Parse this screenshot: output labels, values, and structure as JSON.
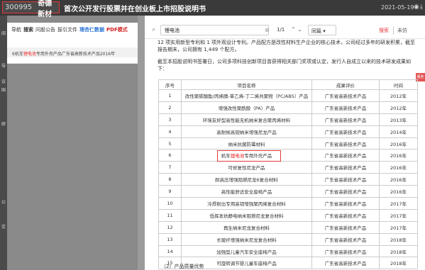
{
  "header": {
    "stock_code": "300995",
    "company": "奇德新材",
    "title": "首次公开发行股票并在创业板上市招股说明书",
    "date": "2021-05-19",
    "icons": [
      "eye-icon",
      "download-icon"
    ]
  },
  "left_strip": {
    "labels": [
      "阅",
      "导",
      "议",
      "国",
      "研",
      "公",
      "交"
    ]
  },
  "panel": {
    "tabs": [
      {
        "label": "导航",
        "style": "normal"
      },
      {
        "label": "搜索",
        "style": "active"
      },
      {
        "label": "问股公告",
        "style": "normal"
      },
      {
        "label": "拔引文件",
        "style": "normal"
      },
      {
        "label": "理杏仁数据",
        "style": "blue"
      },
      {
        "label": "PDF模式",
        "style": "red"
      }
    ],
    "result": {
      "prefix": "6机车",
      "highlight": "锂电池",
      "suffix": "专用外壳产品广东省高新技术产品2016年"
    }
  },
  "search": {
    "icon": "search-icon",
    "query": "锂电池",
    "clear_icon": "clear-icon",
    "count": "1/1",
    "prev_icon": "chevron-up-icon",
    "next_icon": "chevron-down-icon",
    "scope": "同篇 ▾",
    "search_button": "搜索",
    "cancel_button": "未仿"
  },
  "document": {
    "intro_line1": "12 项实用新型专利和 1 项外观设计专利。产品配方是改性材料生产企业的核心技术，公司经过多年的研发积累，截至",
    "intro_line2": "报告期末，公司拥有 1,449 个配方。",
    "para_line1": "截至本招股说明书签署日，公司多项科技创新项目曾获得相关部门奖项或认定，发行人自成立以来的技术研发成果如",
    "para_line2": "下：",
    "feedback_button": "服务",
    "table": {
      "headers": [
        "序号",
        "项目名称",
        "成果评价",
        "时间"
      ],
      "rows": [
        [
          "1",
          "改性聚碳酸酯/丙烯腈-苯乙烯-丁二烯共聚物（PC/ABS）产品",
          "广东省高新技术产品",
          "2012年"
        ],
        [
          "2",
          "增强改性聚酰胺（PA）产品",
          "广东省高新技术产品",
          "2012年"
        ],
        [
          "3",
          "环境友好型高性能无机纳米复合聚丙烯材料",
          "广东省高新技术产品",
          "2013年"
        ],
        [
          "4",
          "高耐候高韧纳米增强尼龙产品",
          "广东省高新技术产品",
          "2014年"
        ],
        [
          "5",
          "纳米抗菌防霉材料",
          "广东省高新技术产品",
          "2016年"
        ],
        [
          "6",
          "机车锂电池专用外壳产品",
          "广东省高新技术产品",
          "2016年"
        ],
        [
          "7",
          "可修复性尼龙产品",
          "广东省高新技术产品",
          "2016年"
        ],
        [
          "8",
          "耐高压增强阻燃尼龙6复合材料",
          "广东省高新技术产品",
          "2016年"
        ],
        [
          "9",
          "高性能舒适安全座椅产品",
          "广东省高新技术产品",
          "2016年"
        ],
        [
          "10",
          "冷焊射出专用高韧增强聚丙烯复合材料",
          "广东省高新技术产品",
          "2017年"
        ],
        [
          "11",
          "低挥发抗静电纳米阻燃尼龙复合材料",
          "广东省高新技术产品",
          "2017年"
        ],
        [
          "12",
          "再生纳米尼龙复合材料",
          "广东省高新技术产品",
          "2017年"
        ],
        [
          "13",
          "长玻纤增强纳米尼龙复合材料",
          "广东省高新技术产品",
          "2018年"
        ],
        [
          "14",
          "加强型儿童汽车安全座椅产品",
          "广东省高新技术产品",
          "2018年"
        ],
        [
          "15",
          "可旋转调节婴儿童车座椅产品",
          "广东省高新技术产品",
          "2018年"
        ]
      ],
      "highlight_row": 6,
      "highlight_prefix": "机车",
      "highlight_term": "锂电池",
      "highlight_suffix": "专用外壳产品"
    },
    "footer": "（2）产品质量优势"
  },
  "colors": {
    "accent_red": "#e03a3a",
    "link_blue": "#2b74d6",
    "topbar": "#3a3a3a"
  }
}
